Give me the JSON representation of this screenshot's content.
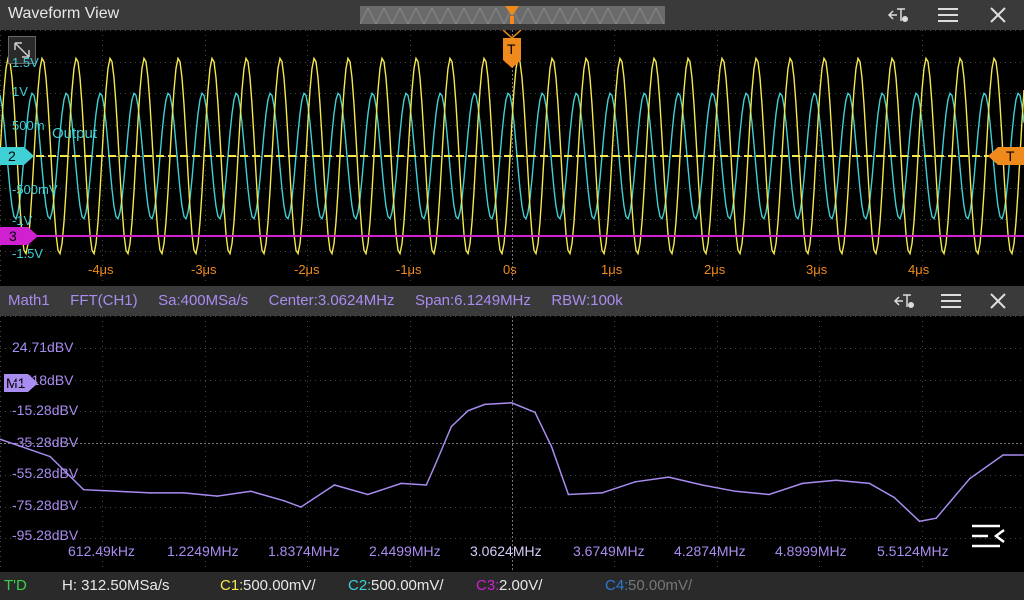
{
  "waveform_view": {
    "title": "Waveform View",
    "y_labels": [
      "1.5V",
      "1V",
      "500m",
      "-500mV",
      "-1V",
      "-1.5V"
    ],
    "x_labels": [
      "-4μs",
      "-3μs",
      "-2μs",
      "-1μs",
      "0s",
      "1μs",
      "2μs",
      "3μs",
      "4μs"
    ],
    "channel_markers": {
      "ch2": "2",
      "ch3": "3"
    },
    "trigger_label": "T",
    "output_label": "Output",
    "colors": {
      "ch1": "#f5e94c",
      "ch2": "#3fd0d6",
      "ch3": "#d020d0",
      "trigger": "#f08a1c",
      "grid": "#555"
    }
  },
  "math_view": {
    "name": "Math1",
    "function": "FFT(CH1)",
    "sample_rate": "Sa:400MSa/s",
    "center": "Center:3.0624MHz",
    "span": "Span:6.1249MHz",
    "rbw": "RBW:100k",
    "marker": "M1",
    "y_labels": [
      "24.71dBV",
      "4.718dBV",
      "-15.28dBV",
      "-35.28dBV",
      "-55.28dBV",
      "-75.28dBV",
      "-95.28dBV"
    ],
    "x_labels": [
      "612.49kHz",
      "1.2249MHz",
      "1.8374MHz",
      "2.4499MHz",
      "3.0624MHz",
      "3.6749MHz",
      "4.2874MHz",
      "4.8999MHz",
      "5.5124MHz"
    ],
    "color": "#a98cf0",
    "chart_data": {
      "type": "line",
      "x": [
        0.0,
        0.3,
        0.5,
        0.7,
        0.9,
        1.1,
        1.3,
        1.5,
        1.7,
        1.8,
        2.0,
        2.2,
        2.4,
        2.55,
        2.6,
        2.7,
        2.8,
        2.9,
        3.06,
        3.2,
        3.3,
        3.4,
        3.6,
        3.8,
        4.0,
        4.2,
        4.4,
        4.6,
        4.8,
        5.0,
        5.2,
        5.35,
        5.5,
        5.6,
        5.8,
        6.0,
        6.12
      ],
      "y": [
        -33,
        -44,
        -65,
        -66,
        -67,
        -67,
        -69,
        -66,
        -72,
        -76,
        -62,
        -68,
        -61,
        -62,
        -50,
        -25,
        -15,
        -11,
        -10,
        -16,
        -38,
        -68,
        -67,
        -60,
        -57,
        -62,
        -66,
        -68,
        -61,
        -59,
        -61,
        -70,
        -85,
        -83,
        -58,
        -43,
        -43
      ],
      "xlabel": "",
      "ylabel": "",
      "ylim": [
        -100,
        30
      ],
      "xlim": [
        0,
        6.1249
      ]
    }
  },
  "status_bar": {
    "trig_mode": "T'D",
    "horizontal": "H: 312.50MSa/s",
    "c1_label": "C1:",
    "c1_value": "500.00mV/",
    "c2_label": "C2:",
    "c2_value": "500.00mV/",
    "c3_label": "C3:",
    "c3_value": "2.00V/",
    "c4_label": "C4:",
    "c4_value": "50.00mV/"
  },
  "icons": [
    "fit-icon",
    "menu-icon",
    "close-icon",
    "scale-icon",
    "collapse-icon"
  ]
}
